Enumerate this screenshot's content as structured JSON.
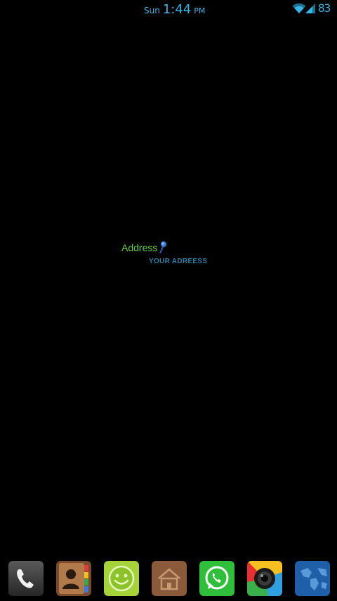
{
  "status_bar": {
    "day": "Sun",
    "time": "1:44",
    "ampm": "PM",
    "battery": "83",
    "wifi_icon": "wifi-icon",
    "signal_icon": "cell-signal-icon",
    "accent_color": "#33b5e5"
  },
  "address_widget": {
    "label": "Address",
    "value": "YOUR ADREESS",
    "pin_icon": "map-pin-icon",
    "label_color": "#5cd43a",
    "value_color": "#2a7fa8"
  },
  "dock": {
    "apps": [
      {
        "name": "phone",
        "icon": "phone-icon"
      },
      {
        "name": "contacts",
        "icon": "contacts-icon"
      },
      {
        "name": "messaging",
        "icon": "smiley-icon"
      },
      {
        "name": "home",
        "icon": "house-icon"
      },
      {
        "name": "whatsapp",
        "icon": "whatsapp-icon"
      },
      {
        "name": "camera",
        "icon": "camera-icon"
      },
      {
        "name": "browser",
        "icon": "globe-icon"
      }
    ]
  }
}
